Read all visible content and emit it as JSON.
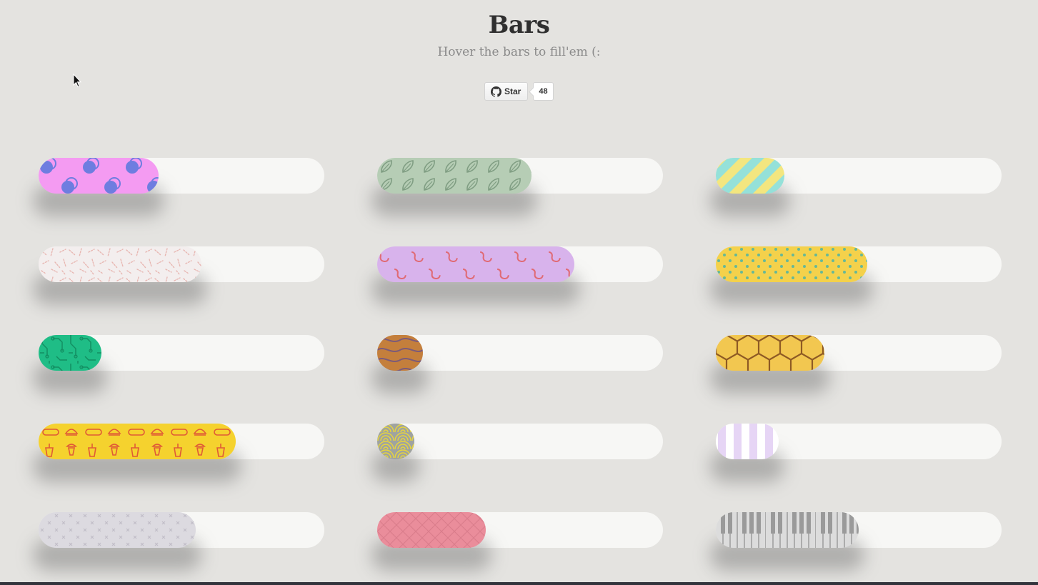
{
  "header": {
    "title": "Bars",
    "subtitle": "Hover the bars to fill'em (:"
  },
  "github": {
    "star_label": "Star",
    "star_count": "48",
    "icon": "github-icon"
  },
  "colors": {
    "background": "#e4e3e0",
    "track": "#f7f7f5",
    "title": "#2f2f2f",
    "subtitle": "#8a8a8a"
  },
  "bars": [
    {
      "id": "bar-1",
      "pattern": "pink-circles",
      "colors": [
        "#f49bf2",
        "#6e7de0"
      ],
      "fill_percent": 42
    },
    {
      "id": "bar-2",
      "pattern": "green-leaves",
      "colors": [
        "#b6cdb5",
        "#7f9d82"
      ],
      "fill_percent": 54
    },
    {
      "id": "bar-3",
      "pattern": "mint-yellow-stripes",
      "colors": [
        "#95e1d9",
        "#f3e67f"
      ],
      "fill_percent": 24
    },
    {
      "id": "bar-4",
      "pattern": "pink-dashes",
      "colors": [
        "#f3eeee",
        "#e8b7b2"
      ],
      "fill_percent": 57
    },
    {
      "id": "bar-5",
      "pattern": "lilac-waves",
      "colors": [
        "#d8b3ec",
        "#e06a74"
      ],
      "fill_percent": 69
    },
    {
      "id": "bar-6",
      "pattern": "yellow-dots",
      "colors": [
        "#f4d14b",
        "#66b897"
      ],
      "fill_percent": 53
    },
    {
      "id": "bar-7",
      "pattern": "green-circuit",
      "colors": [
        "#1fbd86",
        "#138f62"
      ],
      "fill_percent": 22
    },
    {
      "id": "bar-8",
      "pattern": "wood-grain",
      "colors": [
        "#c47f3c",
        "#7c5a78"
      ],
      "fill_percent": 16
    },
    {
      "id": "bar-9",
      "pattern": "honeycomb",
      "colors": [
        "#f2c750",
        "#8e5a24"
      ],
      "fill_percent": 38
    },
    {
      "id": "bar-10",
      "pattern": "fast-food",
      "colors": [
        "#f5d22e",
        "#e05a36"
      ],
      "fill_percent": 69
    },
    {
      "id": "bar-11",
      "pattern": "seigaiha-waves",
      "colors": [
        "#9fa3a0",
        "#e7d53c"
      ],
      "fill_percent": 13
    },
    {
      "id": "bar-12",
      "pattern": "lavender-stripes",
      "colors": [
        "#e6d5f5",
        "#ffffff"
      ],
      "fill_percent": 22
    },
    {
      "id": "bar-13",
      "pattern": "grey-crosses",
      "colors": [
        "#dcdae0",
        "#c1bdc8"
      ],
      "fill_percent": 55
    },
    {
      "id": "bar-14",
      "pattern": "pink-texture",
      "colors": [
        "#ea8d9b",
        "#d97c8b"
      ],
      "fill_percent": 38
    },
    {
      "id": "bar-15",
      "pattern": "piano-keys",
      "colors": [
        "#c7c7c7",
        "#8c8c8c"
      ],
      "fill_percent": 50
    }
  ]
}
